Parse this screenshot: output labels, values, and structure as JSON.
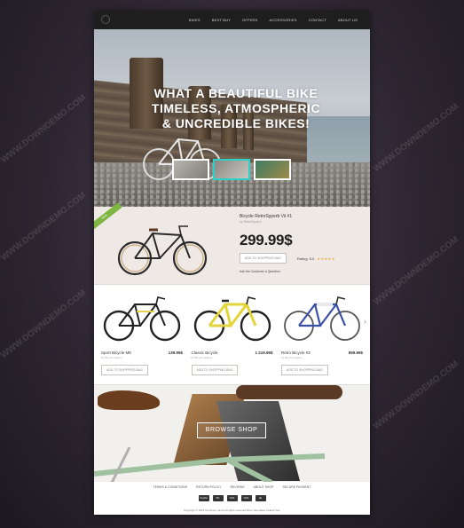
{
  "nav": {
    "items": [
      {
        "label": "BIKES"
      },
      {
        "label": "BEST BUY"
      },
      {
        "label": "OFFERS"
      },
      {
        "label": "ACCESSORIES"
      },
      {
        "label": "CONTACT"
      },
      {
        "label": "ABOUT US"
      }
    ]
  },
  "hero": {
    "title_line1": "WHAT A BEAUTIFUL BIKE",
    "title_line2": "TIMELESS, ATMOSPHERIC",
    "title_line3": "& UNCREDIBLE BIKES!"
  },
  "featured": {
    "ribbon": "NEW",
    "title": "Bicycle RetroSyperb Vii #1",
    "subtitle": "by RetroSuperb",
    "price": "299.99$",
    "button": "ADD TO SHOPPING BAG",
    "rating_label": "Rating: 5.0",
    "stars": "★★★★★",
    "ask": "Ask the Customer a Question"
  },
  "products": [
    {
      "name": "Sport Bicycle M8",
      "sub": "by Bicycle Gallery",
      "price": "139.99$",
      "button": "ADD TO SHOPPING BAG"
    },
    {
      "name": "Classic Bicycle",
      "sub": "by Bicycle Gallery",
      "price": "1 219.99$",
      "button": "ADD TO SHOPPING BAG"
    },
    {
      "name": "Retro Bicycle #2",
      "sub": "by Bicycle Gallery",
      "price": "899.99$",
      "button": "ADD TO SHOPPING BAG"
    }
  ],
  "banner": {
    "button": "BROWSE SHOP"
  },
  "footer": {
    "links": [
      {
        "label": "TERMS & CONDITIONS"
      },
      {
        "label": "RETURN POLICY"
      },
      {
        "label": "REVIEWS"
      },
      {
        "label": "ABOUT SHOP"
      },
      {
        "label": "SECURE PAYMENT"
      }
    ],
    "payments": [
      "PayPal",
      "MC",
      "VISA",
      "VISA",
      "AE"
    ],
    "copyright": "Copyright © 2016 Company name All rights reserved More Templates     Collect from"
  },
  "watermark": "WWW.DOWNDEMO.COM"
}
